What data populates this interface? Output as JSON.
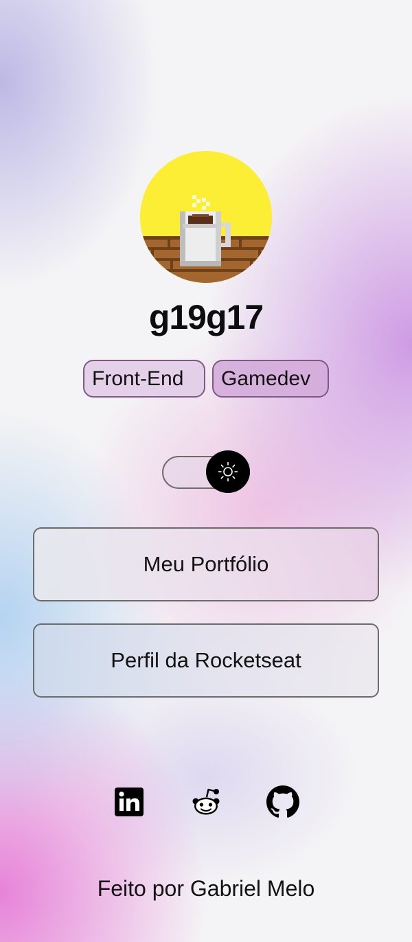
{
  "profile": {
    "username": "g19g17",
    "tags": [
      "Front-End",
      "Gamedev"
    ]
  },
  "theme_toggle": {
    "mode": "light",
    "icon": "sun-icon"
  },
  "links": [
    {
      "label": "Meu Portfólio"
    },
    {
      "label": "Perfil da Rocketseat"
    }
  ],
  "socials": [
    {
      "name": "LinkedIn",
      "icon": "linkedin-icon"
    },
    {
      "name": "Reddit",
      "icon": "reddit-icon"
    },
    {
      "name": "GitHub",
      "icon": "github-icon"
    }
  ],
  "footer": {
    "prefix": "Feito por",
    "author": "Gabriel Melo"
  },
  "colors": {
    "avatar_bg": "#fbee34",
    "tag_border": "#7d5a85",
    "knob": "#000000"
  }
}
